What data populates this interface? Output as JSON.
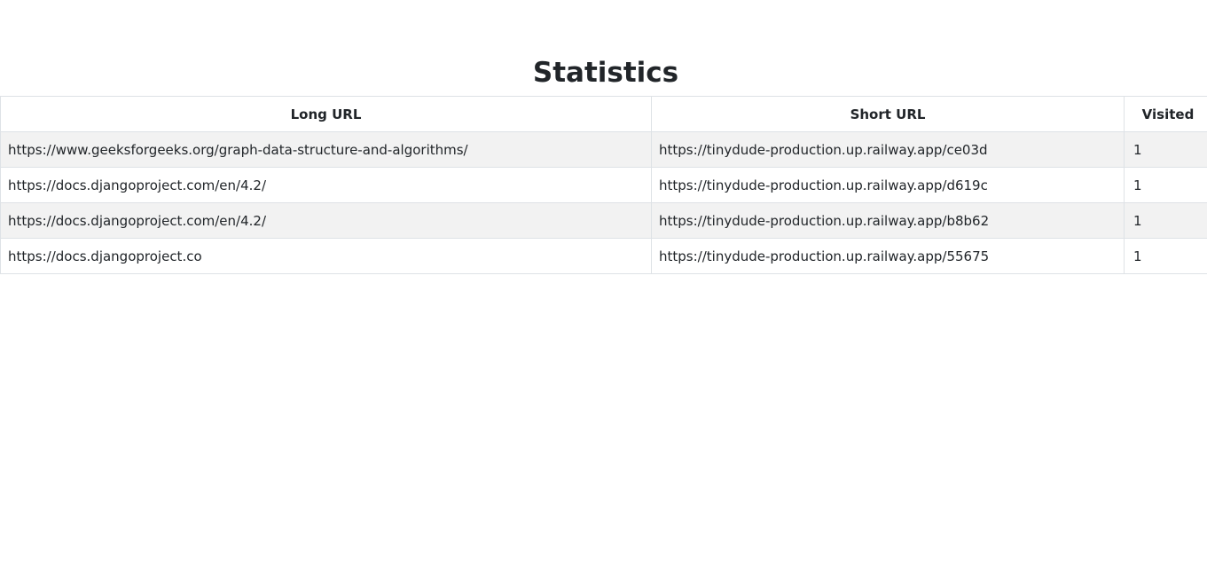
{
  "page": {
    "title": "Statistics"
  },
  "table": {
    "headers": {
      "long_url": "Long URL",
      "short_url": "Short URL",
      "visited": "Visited"
    },
    "rows": [
      {
        "long_url": "https://www.geeksforgeeks.org/graph-data-structure-and-algorithms/",
        "short_url": "https://tinydude-production.up.railway.app/ce03d",
        "visited": "1"
      },
      {
        "long_url": "https://docs.djangoproject.com/en/4.2/",
        "short_url": "https://tinydude-production.up.railway.app/d619c",
        "visited": "1"
      },
      {
        "long_url": "https://docs.djangoproject.com/en/4.2/",
        "short_url": "https://tinydude-production.up.railway.app/b8b62",
        "visited": "1"
      },
      {
        "long_url": "https://docs.djangoproject.co",
        "short_url": "https://tinydude-production.up.railway.app/55675",
        "visited": "1"
      }
    ]
  },
  "colors": {
    "text": "#212529",
    "border": "#dee2e6",
    "stripe": "#f2f2f2"
  }
}
